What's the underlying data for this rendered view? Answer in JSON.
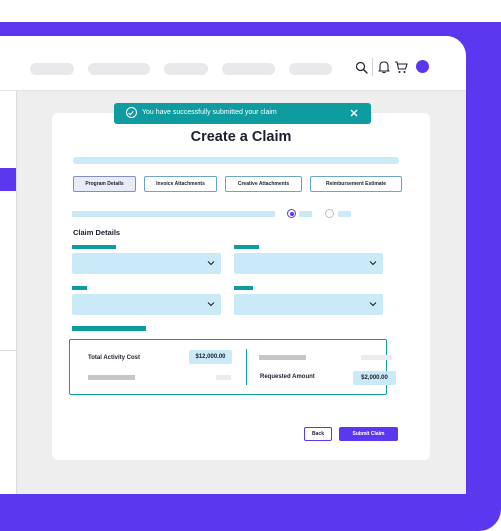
{
  "toast": {
    "message": "You have successfully submitted your claim"
  },
  "page": {
    "title": "Create a Claim"
  },
  "tabs": [
    {
      "label": "Program Details",
      "active": true
    },
    {
      "label": "Invoice Attachments",
      "active": false
    },
    {
      "label": "Creative Attachments",
      "active": false
    },
    {
      "label": "Reimbursement Estimate",
      "active": false
    }
  ],
  "claim": {
    "section_title": "Claim Details"
  },
  "summary": {
    "total_activity_cost_label": "Total Activity Cost",
    "total_activity_cost_value": "$12,000.00",
    "requested_amount_label": "Requested Amount",
    "requested_amount_value": "$2,000.00"
  },
  "actions": {
    "back_label": "Back",
    "submit_label": "Submit Claim"
  },
  "colors": {
    "brand_purple": "#5b37ef",
    "teal": "#0e9ca1",
    "field_blue": "#cbeaf7",
    "page_bg": "#eeeeef"
  },
  "icons": [
    "search-icon",
    "bell-icon",
    "cart-icon",
    "check-circle-icon",
    "close-icon",
    "chevron-down-icon"
  ]
}
